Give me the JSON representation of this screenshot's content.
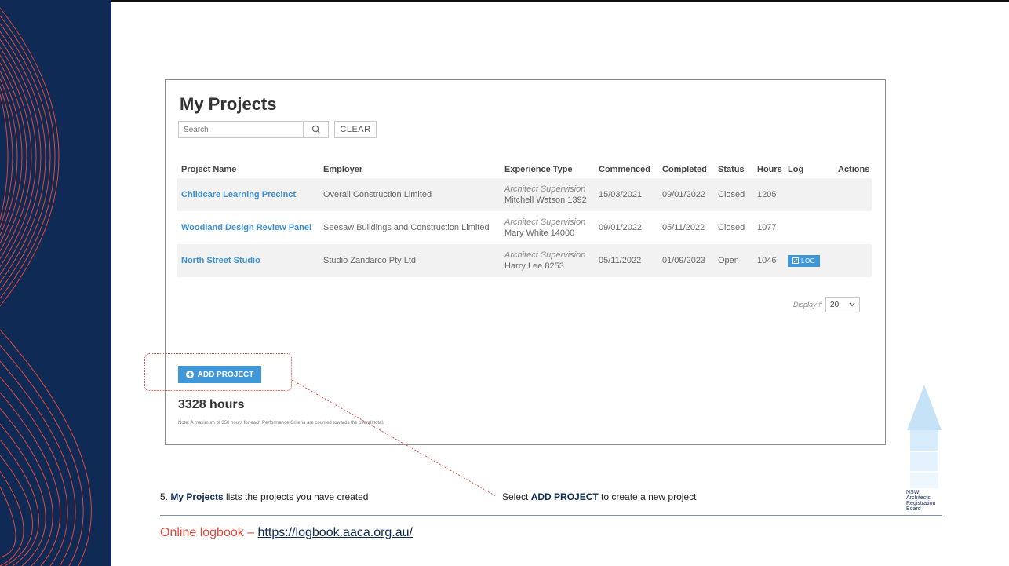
{
  "panel": {
    "title": "My Projects",
    "search_placeholder": "Search",
    "clear_label": "CLEAR",
    "columns": [
      "Project Name",
      "Employer",
      "Experience Type",
      "Commenced",
      "Completed",
      "Status",
      "Hours",
      "Log",
      "Actions"
    ],
    "rows": [
      {
        "name": "Childcare Learning Precinct",
        "employer": "Overall Construction Limited",
        "exp_type": "Architect Supervision",
        "supervisor": "Mitchell Watson 1392",
        "commenced": "15/03/2021",
        "completed": "09/01/2022",
        "status": "Closed",
        "hours": "1205"
      },
      {
        "name": "Woodland Design Review Panel",
        "employer": "Seesaw Buildings and Construction Limited",
        "exp_type": "Architect Supervision",
        "supervisor": "Mary White 14000",
        "commenced": "09/01/2022",
        "completed": "05/11/2022",
        "status": "Closed",
        "hours": "1077"
      },
      {
        "name": "North Street Studio",
        "employer": "Studio Zandarco Pty Ltd",
        "exp_type": "Architect Supervision",
        "supervisor": "Harry Lee 8253",
        "commenced": "05/11/2022",
        "completed": "01/09/2023",
        "status": "Open",
        "hours": "1046",
        "log": "LOG"
      }
    ],
    "display_label": "Display #",
    "display_value": "20",
    "add_project_label": "ADD PROJECT",
    "total_hours": "3328 hours",
    "note": "Note: A maximum of 350 hours for each Performance Criteria are counted towards the overall total."
  },
  "captions": {
    "step_prefix": "5. ",
    "step_bold": "My Projects",
    "step_rest": " lists the projects you have created",
    "select_prefix": "Select ",
    "select_bold": "ADD PROJECT",
    "select_rest": " to create a new project"
  },
  "footer": {
    "prefix": "Online logbook – ",
    "link": "https://logbook.aaca.org.au/"
  },
  "logo": {
    "lines": [
      "NSW",
      "Architects",
      "Registration",
      "Board"
    ]
  },
  "colors": {
    "band": "#0e2a55",
    "accent_red": "#e0483b",
    "button_blue": "#3f97d8",
    "link_blue": "#3b8fd3"
  }
}
